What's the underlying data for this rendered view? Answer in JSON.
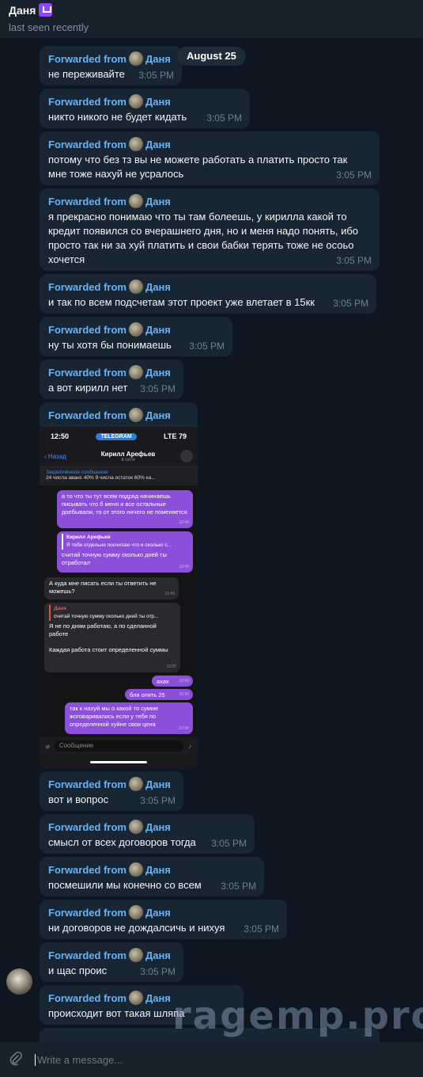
{
  "header": {
    "name": "Даня",
    "status": "last seen recently"
  },
  "date_label": "August 25",
  "forwarded_prefix": "Forwarded from",
  "forwarded_name": "Даня",
  "messages": [
    {
      "text": "не переживайте",
      "time": "3:05 PM"
    },
    {
      "text": "никто никого не будет кидать",
      "time": "3:05 PM"
    },
    {
      "text": "потому что без тз вы не можете работать а платить просто так мне тоже нахуй не усралось",
      "time": "3:05 PM"
    },
    {
      "text": "я прекрасно понимаю что ты там болеешь, у кирилла какой то кредит появился со вчерашнего дня, но и меня надо понять, ибо просто так ни за хуй платить и свои бабки терять тоже не осоьо хочется",
      "time": "3:05 PM"
    },
    {
      "text": "и так по всем подсчетам этот проект уже влетает в 15кк",
      "time": "3:05 PM"
    },
    {
      "text": "ну ты хотя бы понимаешь",
      "time": "3:05 PM"
    },
    {
      "text": "а вот кирилл нет",
      "time": "3:05 PM"
    },
    {
      "text": "вот и вопрос",
      "time": "3:05 PM"
    },
    {
      "text": "смысл от всех договоров тогда",
      "time": "3:05 PM"
    },
    {
      "text": "посмешили мы конечно со всем",
      "time": "3:05 PM"
    },
    {
      "text": "ни договоров не дождалсичь и нихуя",
      "time": "3:05 PM"
    },
    {
      "text": "и щас проис",
      "time": "3:05 PM"
    },
    {
      "text": "происходит вот такая шляпа",
      "time": ""
    }
  ],
  "screenshot": {
    "clock": "12:50",
    "app_pill": "TELEGRAM",
    "signal": "LTE 79",
    "back": "Назад",
    "contact": "Кирилл Арефьев",
    "contact_status": "в сети",
    "pinned_title": "Закреплённое сообщение",
    "pinned_text": "24 числа аванс 40% 9 числа остаток 60% ка...",
    "bubbles": [
      {
        "text": "а то что ты тут всем подряд начинаешь писывать что б меня и все остальные доебывали, то от этого ничего не поменяется",
        "time": "12:49"
      },
      {
        "quote_name": "Кирилл Арефьев",
        "quote_text": "Я тебе отдельно посчитаю что и сколько с...",
        "text": "считай точную сумму сколько дней ты отработал",
        "time": "12:49"
      },
      {
        "text": "А куда мне писать если ты ответить не можешь?",
        "time": "12:49"
      },
      {
        "quote_name": "Даня",
        "quote_text": "считай точную сумму сколько дней ты отр...",
        "text": "Я не по дням работаю, а по сделанной работе\n\nКаждая работа стоит определенной суммы",
        "time": "12:50"
      },
      {
        "text": "ахах",
        "time": "12:50"
      },
      {
        "text": "бля опять 25",
        "time": "12:50"
      },
      {
        "text": "так к нахуй мы о какой то сумме жоговаривались если у тебя по определенной хуйне своя цена",
        "time": "12:50"
      }
    ],
    "input_placeholder": "Сообщение"
  },
  "watermark": "ragemp.pro",
  "composer": {
    "placeholder": "Write a message..."
  },
  "colors": {
    "bg": "#0e1621",
    "bubble": "#182533",
    "accent": "#6ab3f3",
    "header": "#17212b"
  }
}
